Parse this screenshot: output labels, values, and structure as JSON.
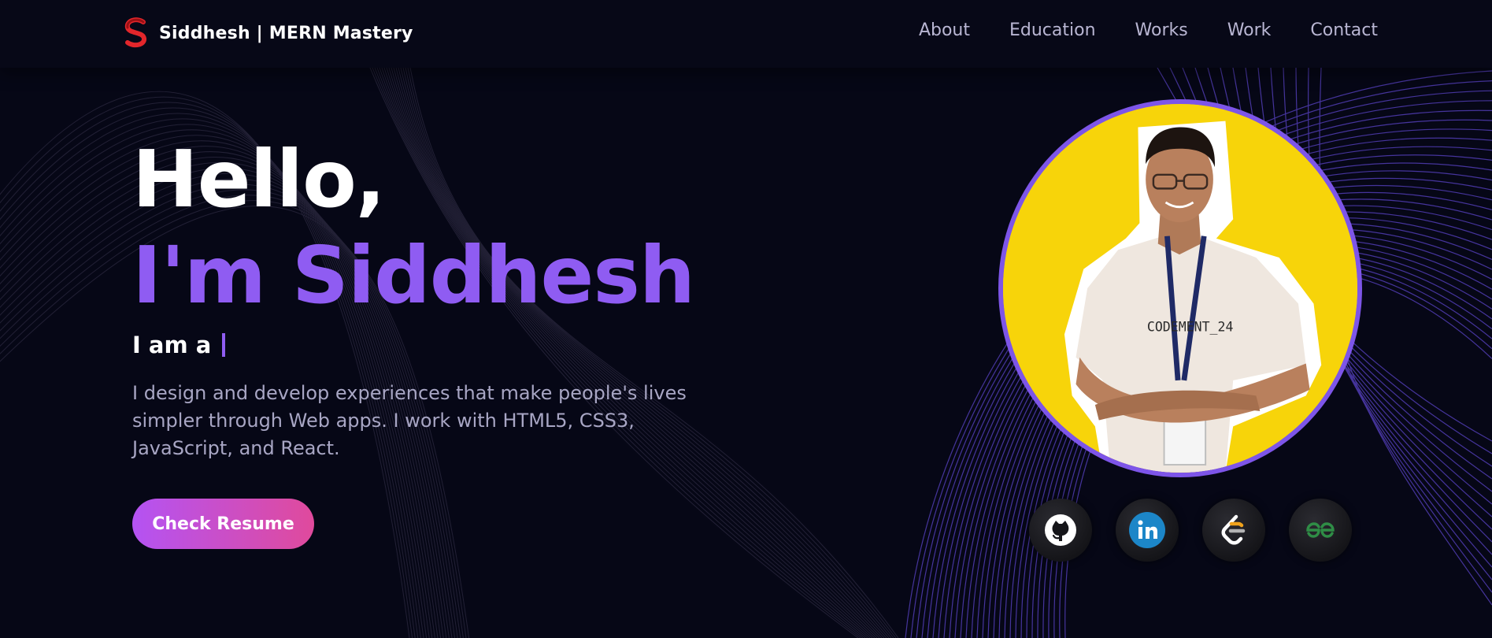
{
  "nav": {
    "brand": "Siddhesh  | MERN Mastery",
    "links": [
      "About",
      "Education",
      "Works",
      "Work",
      "Contact"
    ]
  },
  "hero": {
    "greeting": "Hello,",
    "name": "I'm Siddhesh",
    "role_prefix": "I am a",
    "description": "I design and develop experiences that make people's lives simpler through Web apps. I work with HTML5, CSS3, JavaScript, and React.",
    "cta": "Check Resume"
  },
  "profile": {
    "shirt_text": "CODEMENT_24"
  },
  "socials": [
    "github-icon",
    "linkedin-icon",
    "leetcode-icon",
    "geeksforgeeks-icon"
  ],
  "colors": {
    "background": "#060716",
    "accent": "#8f5cf2",
    "muted_text": "#a8a6c4",
    "button_gradient_start": "#b453f3",
    "button_gradient_end": "#e04a9c",
    "photo_bg": "#f7d40a"
  }
}
